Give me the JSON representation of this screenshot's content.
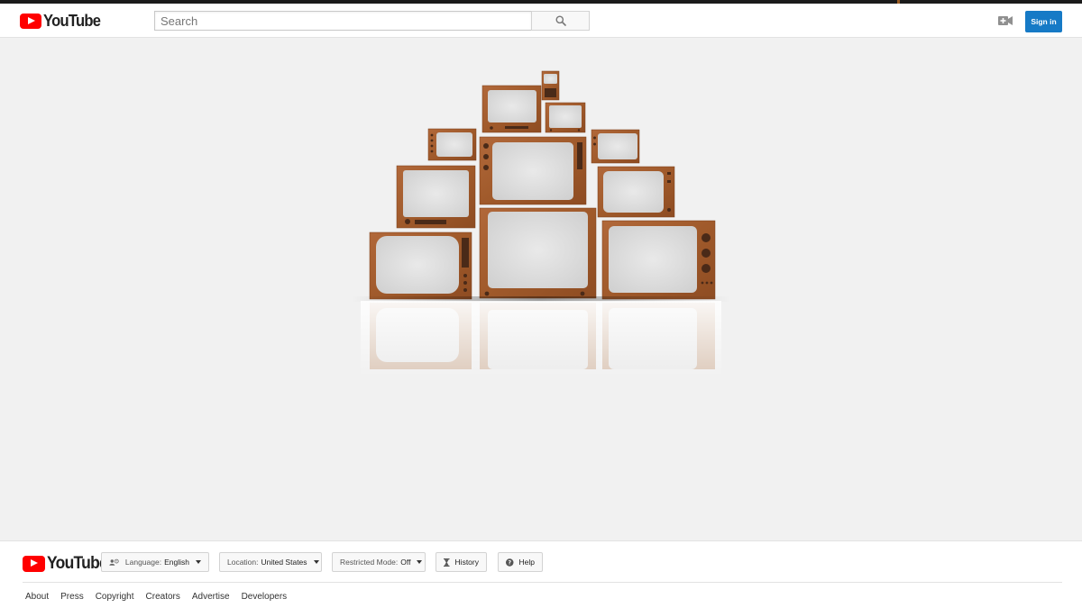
{
  "masthead": {
    "logo_text": "YouTube",
    "search_placeholder": "Search",
    "signin_label": "Sign in"
  },
  "icons": {
    "search": "search-icon",
    "upload": "video-camera-plus-icon",
    "language": "people-icon",
    "history": "hourglass-icon",
    "help": "question-circle-icon"
  },
  "colors": {
    "brand_red": "#ff0000",
    "signin_blue": "#167ac6",
    "tv_wood": "#a0582a",
    "page_bg": "#f1f1f1"
  },
  "footer": {
    "logo_text": "YouTube",
    "language_label": "Language:",
    "language_value": "English",
    "location_label": "Location:",
    "location_value": "United States",
    "restricted_label": "Restricted Mode:",
    "restricted_value": "Off",
    "history_label": "History",
    "help_label": "Help",
    "links": [
      "About",
      "Press",
      "Copyright",
      "Creators",
      "Advertise",
      "Developers"
    ]
  }
}
